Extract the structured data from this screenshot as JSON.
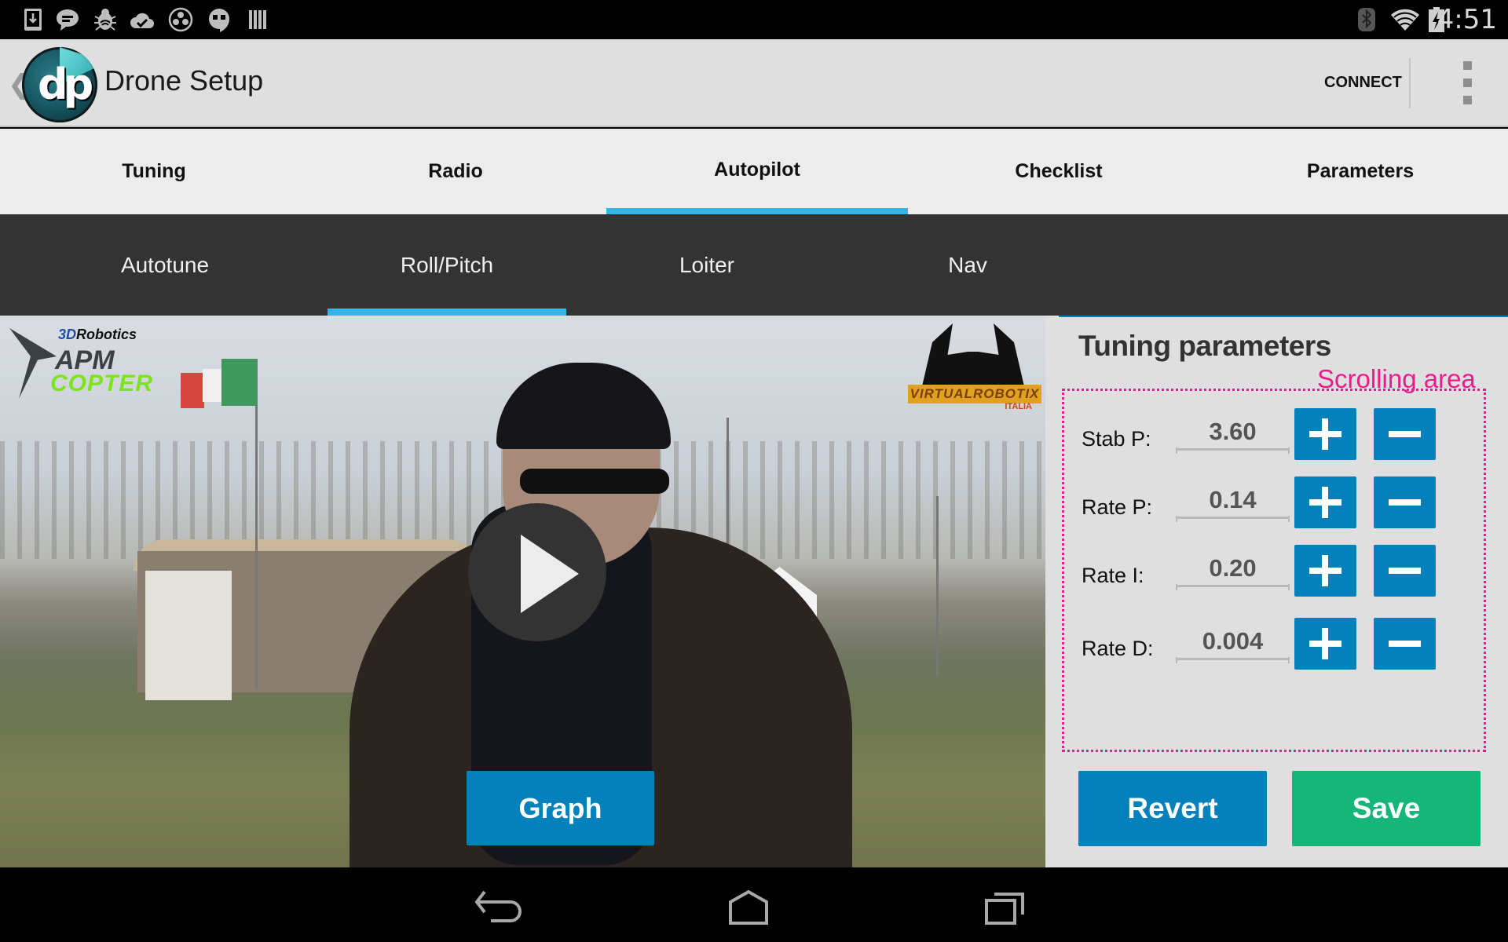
{
  "status_bar": {
    "left_icons": [
      "download-icon",
      "chat-bubble-icon",
      "bug-icon",
      "cloud-check-icon",
      "circle-people-icon",
      "quote-bubble-icon",
      "barcode-icon"
    ],
    "right_icons": [
      "bluetooth-icon",
      "wifi-icon",
      "battery-charging-icon"
    ],
    "time": "4:51"
  },
  "action_bar": {
    "title": "Drone Setup",
    "logo_text": "dp",
    "connect_label": "CONNECT",
    "overflow_icon": "overflow-menu-icon"
  },
  "top_tabs": [
    {
      "label": "Tuning",
      "active": false
    },
    {
      "label": "Radio",
      "active": false
    },
    {
      "label": "Autopilot",
      "active": true
    },
    {
      "label": "Checklist",
      "active": false
    },
    {
      "label": "Parameters",
      "active": false
    }
  ],
  "sub_tabs": [
    {
      "label": "Autotune",
      "active": false
    },
    {
      "label": "Roll/Pitch",
      "active": true
    },
    {
      "label": "Loiter",
      "active": false
    },
    {
      "label": "Nav",
      "active": false
    }
  ],
  "video": {
    "logo_left_brand_prefix": "3D",
    "logo_left_brand": "Robotics",
    "logo_left_line1": "APM",
    "logo_left_line2": "COPTER",
    "logo_right_text": "VIRTUALROBOTIX",
    "logo_right_sub": "ITALIA",
    "play_icon": "play-icon",
    "graph_label": "Graph"
  },
  "panel": {
    "title": "Tuning parameters",
    "scroll_annotation": "Scrolling area",
    "params": [
      {
        "label": "Stab P:",
        "value": "3.60"
      },
      {
        "label": "Rate P:",
        "value": "0.14"
      },
      {
        "label": "Rate I:",
        "value": "0.20"
      },
      {
        "label": "Rate D:",
        "value": "0.004"
      }
    ],
    "revert_label": "Revert",
    "save_label": "Save"
  },
  "colors": {
    "accent_blue": "#33b5e5",
    "button_blue": "#0281bb",
    "save_green": "#16b67a",
    "annotation_pink": "#e91e8c",
    "subtab_bg": "#333333"
  },
  "nav_bar": {
    "icons": [
      "back-icon",
      "home-icon",
      "recent-apps-icon"
    ]
  }
}
